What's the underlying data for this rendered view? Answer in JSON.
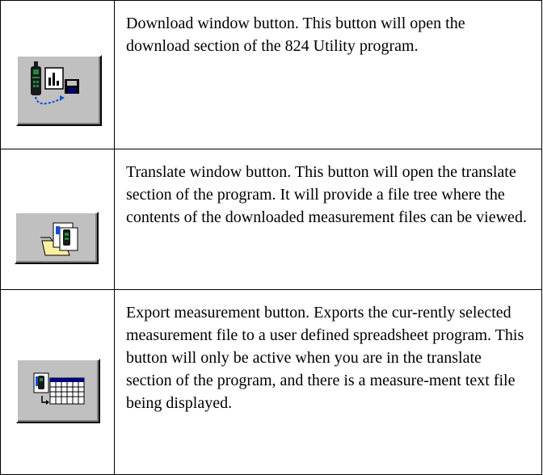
{
  "rows": [
    {
      "icon": "download-window-icon",
      "description": "Download window button. This button will open the download section of the 824 Utility program."
    },
    {
      "icon": "translate-window-icon",
      "description": "Translate window button. This button will open the translate section of the program. It will provide a file tree where the contents of the downloaded measurement files can be viewed."
    },
    {
      "icon": "export-measurement-icon",
      "description": "Export measurement button. Exports the cur-rently selected measurement file to a user defined spreadsheet program. This button will only be active when you are in the translate section of the program, and there is a measure-ment text file being displayed."
    }
  ],
  "colors": {
    "button_face": "#c0c0c0",
    "button_highlight": "#ffffff",
    "button_shadow": "#808080",
    "meter_green": "#1e8c3c",
    "arrow_blue": "#1050d8",
    "folder_yellow": "#f8f0a0",
    "disk_navy": "#00007a"
  }
}
